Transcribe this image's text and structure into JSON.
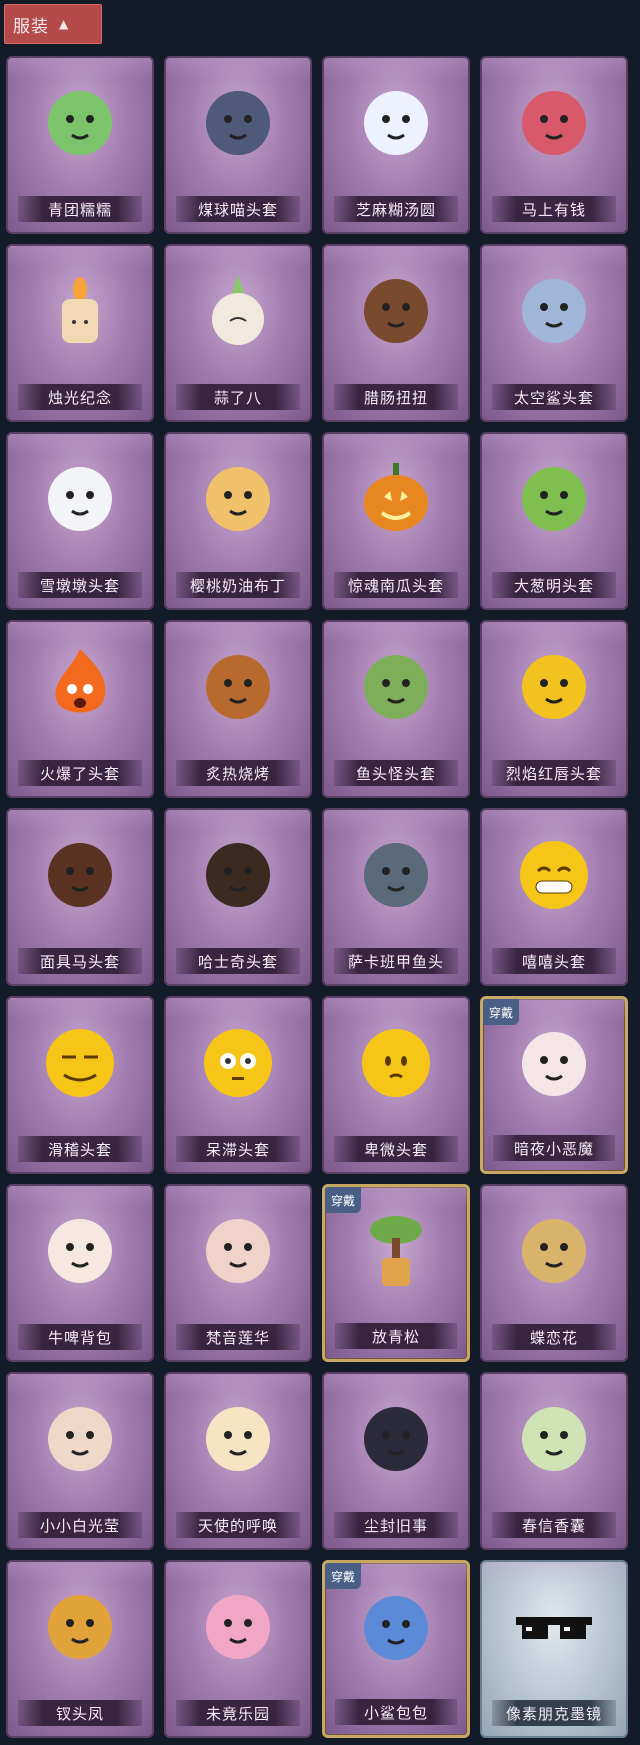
{
  "header": {
    "title": "服装",
    "toggle_icon": "chevron-up-icon"
  },
  "items": [
    {
      "name": "青团糯糯",
      "icon": "green-dumpling",
      "color": "#7cc46b"
    },
    {
      "name": "煤球喵头套",
      "icon": "cat-head",
      "color": "#4f5a7a"
    },
    {
      "name": "芝麻糊汤圆",
      "icon": "rice-ball",
      "color": "#eef1ff"
    },
    {
      "name": "马上有钱",
      "icon": "horse-head",
      "color": "#d85a6a"
    },
    {
      "name": "烛光纪念",
      "icon": "candle",
      "color": "#f3d9b3"
    },
    {
      "name": "蒜了八",
      "icon": "garlic",
      "color": "#f1e9dd"
    },
    {
      "name": "腊肠扭扭",
      "icon": "dachshund",
      "color": "#7a4a2e"
    },
    {
      "name": "太空鲨头套",
      "icon": "shark-head",
      "color": "#9fb6d8"
    },
    {
      "name": "雪墩墩头套",
      "icon": "snowman",
      "color": "#f2f4f8"
    },
    {
      "name": "樱桃奶油布丁",
      "icon": "pudding",
      "color": "#f0c06a"
    },
    {
      "name": "惊魂南瓜头套",
      "icon": "pumpkin",
      "color": "#e8871f"
    },
    {
      "name": "大葱明头套",
      "icon": "scallion",
      "color": "#7fbf4f"
    },
    {
      "name": "火爆了头套",
      "icon": "fireball",
      "color": "#f36a1e"
    },
    {
      "name": "炙热烧烤",
      "icon": "bbq-toast",
      "color": "#b86a2e"
    },
    {
      "name": "鱼头怪头套",
      "icon": "fish-head",
      "color": "#7fae5a"
    },
    {
      "name": "烈焰红唇头套",
      "icon": "yellow-bear",
      "color": "#f2c21e"
    },
    {
      "name": "面具马头套",
      "icon": "horse-mask",
      "color": "#5a3222"
    },
    {
      "name": "哈士奇头套",
      "icon": "husky",
      "color": "#3a2a20"
    },
    {
      "name": "萨卡班甲鱼头",
      "icon": "fish-face",
      "color": "#5a6a7a"
    },
    {
      "name": "嘻嘻头套",
      "icon": "grin-emoji",
      "color": "#f5c518"
    },
    {
      "name": "滑稽头套",
      "icon": "smirk-emoji",
      "color": "#f5c518"
    },
    {
      "name": "呆滞头套",
      "icon": "stare-emoji",
      "color": "#f5c518"
    },
    {
      "name": "卑微头套",
      "icon": "meek-emoji",
      "color": "#f5c518"
    },
    {
      "name": "暗夜小恶魔",
      "icon": "little-devil",
      "color": "#f4e6e6",
      "equipped": true,
      "badge": "穿戴"
    },
    {
      "name": "牛啤背包",
      "icon": "cow-beer",
      "color": "#f5e8e0"
    },
    {
      "name": "梵音莲华",
      "icon": "lotus-figure",
      "color": "#f0d2c8"
    },
    {
      "name": "放青松",
      "icon": "pine-pot",
      "color": "#6faa4a",
      "equipped": true,
      "badge": "穿戴"
    },
    {
      "name": "蝶恋花",
      "icon": "butterfly-ornament",
      "color": "#d9b36a"
    },
    {
      "name": "小小白光莹",
      "icon": "girl-figure",
      "color": "#f0d8c8"
    },
    {
      "name": "天使的呼唤",
      "icon": "angel-figure",
      "color": "#f6e4c2"
    },
    {
      "name": "尘封旧事",
      "icon": "boy-figure",
      "color": "#2a2a3a"
    },
    {
      "name": "春信香囊",
      "icon": "sachet",
      "color": "#cfe3b5"
    },
    {
      "name": "钗头凤",
      "icon": "phoenix-crown",
      "color": "#e2a23a"
    },
    {
      "name": "未竟乐园",
      "icon": "pink-girl",
      "color": "#f1a6c6"
    },
    {
      "name": "小鲨包包",
      "icon": "shark-bag",
      "color": "#5a8ad8",
      "equipped": true,
      "badge": "穿戴"
    },
    {
      "name": "像素朋克墨镜",
      "icon": "pixel-sunglasses",
      "color": "#111111",
      "special": true
    }
  ]
}
